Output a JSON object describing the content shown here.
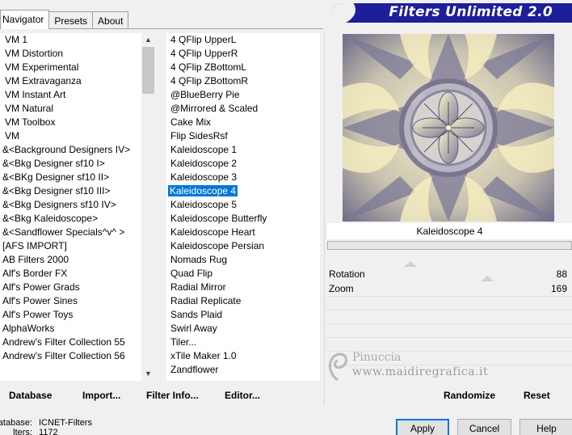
{
  "tabs": [
    {
      "label": "Navigator",
      "active": true
    },
    {
      "label": "Presets",
      "active": false
    },
    {
      "label": "About",
      "active": false
    }
  ],
  "header": {
    "title": "Filters Unlimited 2.0",
    "color": "#1e1e9a"
  },
  "categories": [
    "VM 1",
    "VM Distortion",
    "VM Experimental",
    "VM Extravaganza",
    "VM Instant Art",
    "VM Natural",
    "VM Toolbox",
    "VM",
    "&<Background Designers IV>",
    "&<Bkg Designer sf10 I>",
    "&<BKg Designer sf10 II>",
    "&<Bkg Designer sf10 III>",
    "&<Bkg Designers sf10 IV>",
    "&<Bkg Kaleidoscope>",
    "&<Sandflower Specials^v^ >",
    "[AFS IMPORT]",
    "AB Filters 2000",
    "Alf's Border FX",
    "Alf's Power Grads",
    "Alf's Power Sines",
    "Alf's Power Toys",
    "AlphaWorks",
    "Andrew's Filter Collection 55",
    "Andrew's Filter Collection 56"
  ],
  "filters": [
    "4 QFlip UpperL",
    "4 QFlip UpperR",
    "4 QFlip ZBottomL",
    "4 QFlip ZBottomR",
    "@BlueBerry Pie",
    "@Mirrored & Scaled",
    "Cake Mix",
    "Flip SidesRsf",
    "Kaleidoscope 1",
    "Kaleidoscope 2",
    "Kaleidoscope 3",
    "Kaleidoscope 4",
    "Kaleidoscope 5",
    "Kaleidoscope Butterfly",
    "Kaleidoscope Heart",
    "Kaleidoscope Persian",
    "Nomads Rug",
    "Quad Flip",
    "Radial Mirror",
    "Radial Replicate",
    "Sands Plaid",
    "Swirl Away",
    "Tiler...",
    "xTile Maker 1.0",
    "Zandflower"
  ],
  "selected_filter_index": 11,
  "preview": {
    "filter_name": "Kaleidoscope 4"
  },
  "controls": [
    {
      "label": "Rotation",
      "value": "88",
      "level": 88
    },
    {
      "label": "Zoom",
      "value": "169",
      "level": 169
    }
  ],
  "bottom_actions": {
    "database": "Database",
    "import": "Import...",
    "filter_info": "Filter Info...",
    "editor": "Editor...",
    "randomize": "Randomize",
    "reset": "Reset"
  },
  "status": {
    "database_key": "atabase:",
    "database_value": "ICNET-Filters",
    "filters_key": "lters:",
    "filters_value": "1172"
  },
  "dialog_buttons": {
    "apply": "Apply",
    "cancel": "Cancel",
    "help": "Help"
  },
  "watermark": {
    "name": "Pinuccia",
    "url": "www.maidiregrafica.it"
  }
}
